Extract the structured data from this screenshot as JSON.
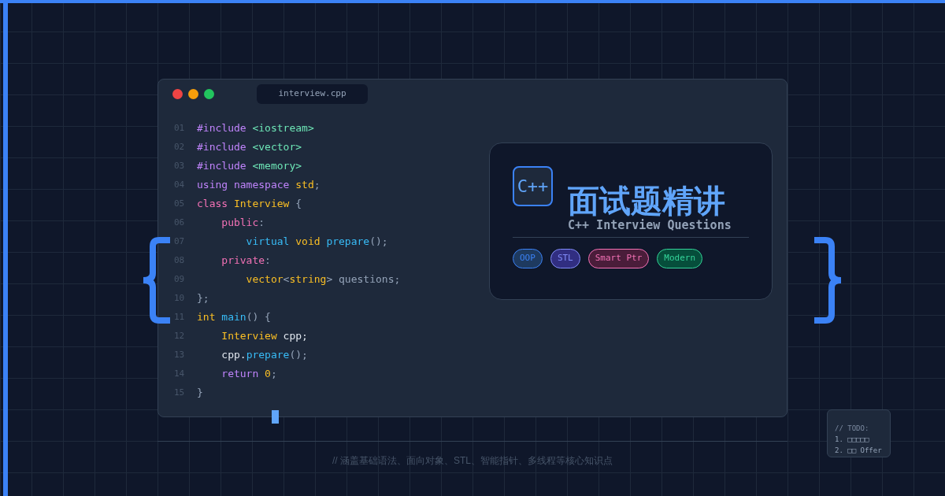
{
  "editor": {
    "tab": "interview.cpp",
    "lines": [
      {
        "number": "01",
        "tokens": [
          {
            "text": "#include ",
            "kind": "keyword"
          },
          {
            "text": "<iostream>",
            "kind": "string"
          }
        ]
      },
      {
        "number": "02",
        "tokens": [
          {
            "text": "#include ",
            "kind": "keyword"
          },
          {
            "text": "<vector>",
            "kind": "string"
          }
        ]
      },
      {
        "number": "03",
        "tokens": [
          {
            "text": "#include ",
            "kind": "keyword"
          },
          {
            "text": "<memory>",
            "kind": "string"
          }
        ]
      },
      {
        "number": "04",
        "tokens": [
          {
            "text": "using namespace ",
            "kind": "keyword"
          },
          {
            "text": "std",
            "kind": "type"
          },
          {
            "text": ";",
            "kind": "plain"
          }
        ]
      },
      {
        "number": "05",
        "tokens": [
          {
            "text": "class ",
            "kind": "access"
          },
          {
            "text": "Interview",
            "kind": "type"
          },
          {
            "text": " {",
            "kind": "plain"
          }
        ]
      },
      {
        "number": "06",
        "tokens": [
          {
            "text": "    public",
            "kind": "access"
          },
          {
            "text": ":",
            "kind": "plain"
          }
        ]
      },
      {
        "number": "07",
        "tokens": [
          {
            "text": "        virtual ",
            "kind": "function"
          },
          {
            "text": "void ",
            "kind": "type"
          },
          {
            "text": "prepare",
            "kind": "function"
          },
          {
            "text": "();",
            "kind": "plain"
          }
        ]
      },
      {
        "number": "08",
        "tokens": [
          {
            "text": "    private",
            "kind": "access"
          },
          {
            "text": ":",
            "kind": "plain"
          }
        ]
      },
      {
        "number": "09",
        "tokens": [
          {
            "text": "        vector",
            "kind": "type"
          },
          {
            "text": "<",
            "kind": "plain"
          },
          {
            "text": "string",
            "kind": "type"
          },
          {
            "text": "> questions;",
            "kind": "plain"
          }
        ]
      },
      {
        "number": "10",
        "tokens": [
          {
            "text": "};",
            "kind": "plain"
          }
        ]
      },
      {
        "number": "11",
        "tokens": [
          {
            "text": "int ",
            "kind": "type"
          },
          {
            "text": "main",
            "kind": "function"
          },
          {
            "text": "() {",
            "kind": "plain"
          }
        ]
      },
      {
        "number": "12",
        "tokens": [
          {
            "text": "    Interview ",
            "kind": "type"
          },
          {
            "text": "cpp;",
            "kind": "ident"
          }
        ]
      },
      {
        "number": "13",
        "tokens": [
          {
            "text": "    cpp.",
            "kind": "ident"
          },
          {
            "text": "prepare",
            "kind": "function"
          },
          {
            "text": "();",
            "kind": "plain"
          }
        ]
      },
      {
        "number": "14",
        "tokens": [
          {
            "text": "    return ",
            "kind": "keyword"
          },
          {
            "text": "0",
            "kind": "type"
          },
          {
            "text": ";",
            "kind": "plain"
          }
        ]
      },
      {
        "number": "15",
        "tokens": [
          {
            "text": "}",
            "kind": "plain"
          }
        ]
      }
    ]
  },
  "card": {
    "badge": "C++",
    "title": "面试题精讲",
    "subtitle": "C++ Interview Questions",
    "tags": [
      {
        "label": "OOP",
        "color": "#3b82f6"
      },
      {
        "label": "STL",
        "color": "#818cf8"
      },
      {
        "label": "Smart Ptr",
        "color": "#f472b6"
      },
      {
        "label": "Modern",
        "color": "#34d399"
      }
    ]
  },
  "note": {
    "heading": "// TODO:",
    "items": [
      "1. □□□□□",
      "2. □□ Offer"
    ]
  },
  "caption": "// 涵盖基础语法、面向对象、STL、智能指针、多线程等核心知识点"
}
